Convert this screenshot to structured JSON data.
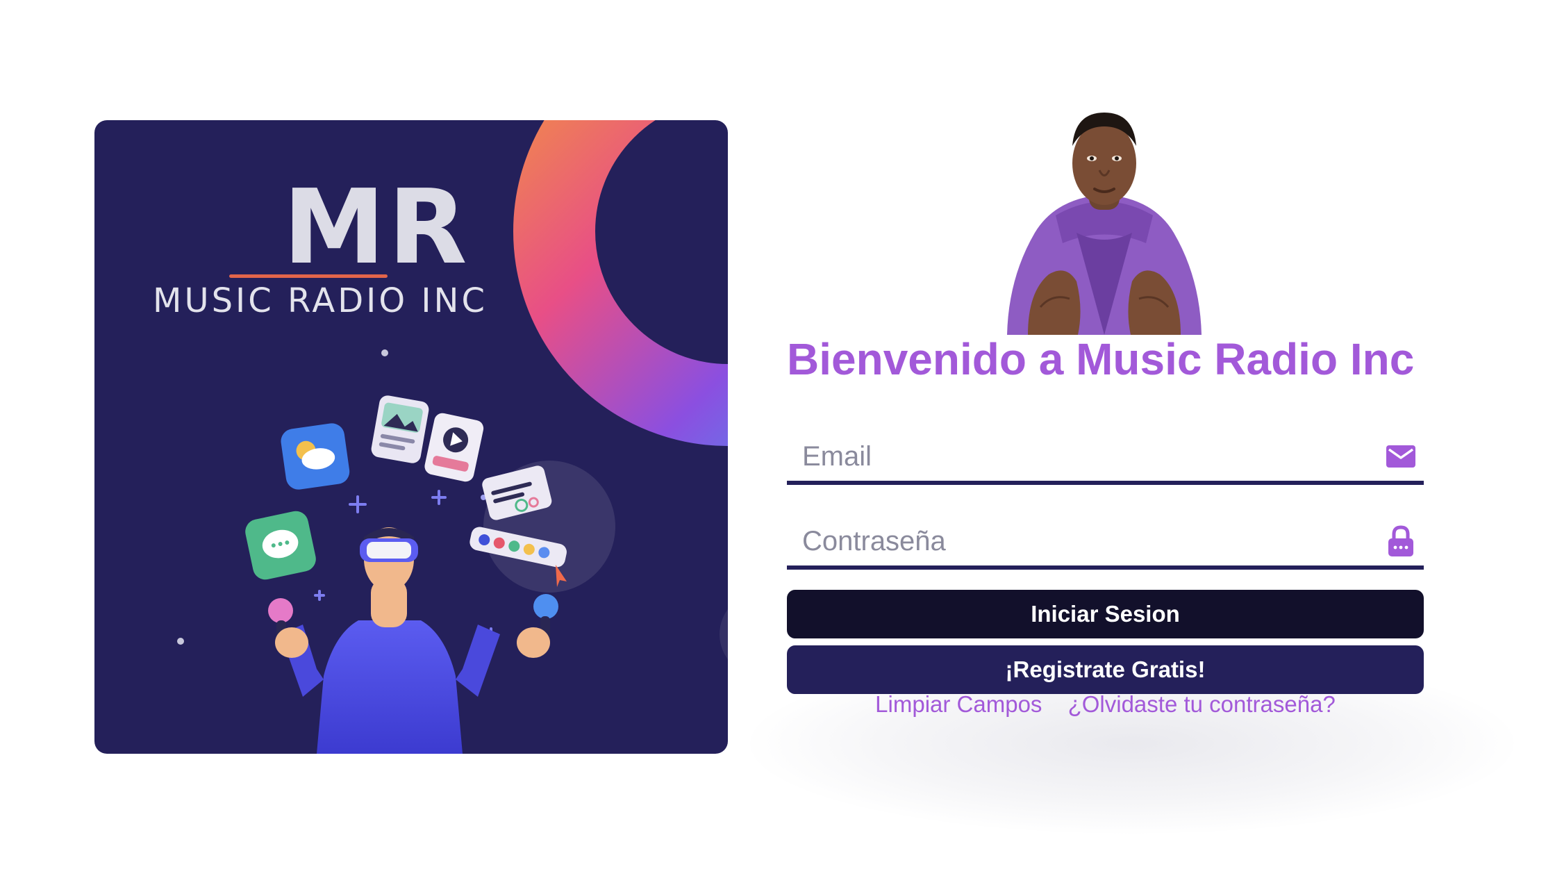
{
  "promo": {
    "logo_letters": "MR",
    "logo_subtitle": "MUSIC RADIO INC",
    "colors": {
      "background": "#24205a",
      "accent_line": "#e2654a"
    }
  },
  "login": {
    "title": "Bienvenido a Music Radio Inc",
    "email": {
      "placeholder": "Email",
      "icon": "envelope-icon"
    },
    "password": {
      "placeholder": "Contraseña",
      "icon": "lock-icon"
    },
    "login_button": "Iniciar Sesion",
    "register_button": "¡Registrate Gratis!",
    "clear_link": "Limpiar Campos",
    "forgot_link": "¿Olvidaste tu contraseña?",
    "colors": {
      "accent": "#a259d9",
      "login_button": "#12102b",
      "register_button": "#24205a",
      "field_underline": "#24205a"
    }
  }
}
